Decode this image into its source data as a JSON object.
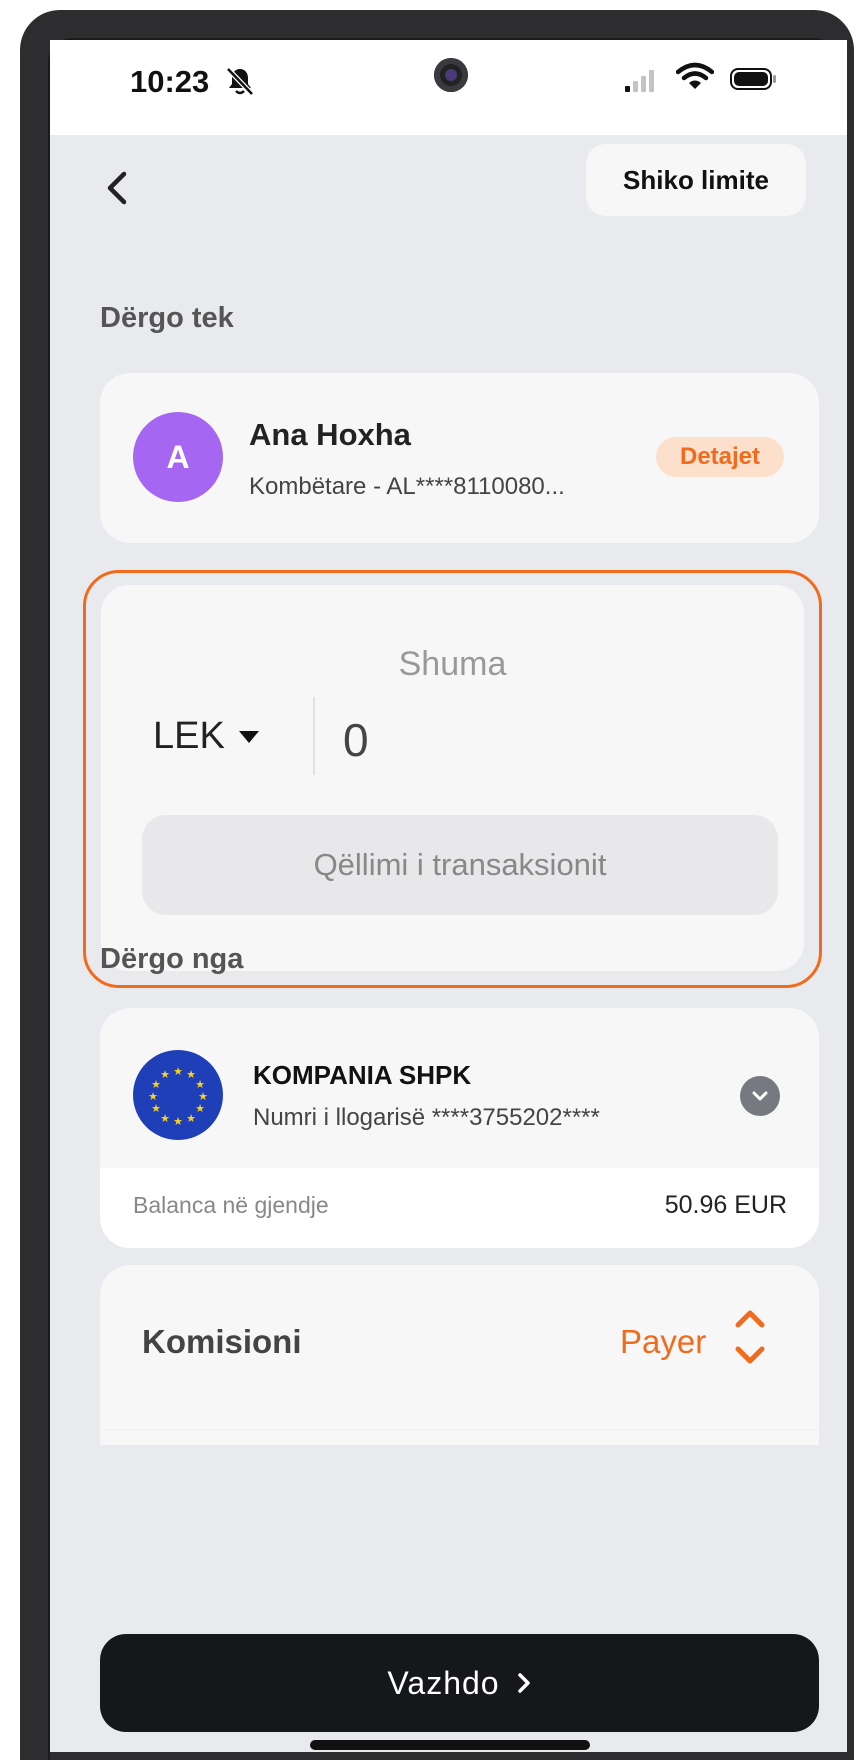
{
  "status_bar": {
    "time": "10:23"
  },
  "header": {
    "limits_label": "Shiko limite"
  },
  "recipient": {
    "section_label": "Dërgo tek",
    "avatar_letter": "A",
    "name": "Ana Hoxha",
    "account": "Kombëtare - AL****8110080...",
    "details_label": "Detajet"
  },
  "amount": {
    "label": "Shuma",
    "currency": "LEK",
    "value": "0",
    "purpose_placeholder": "Qëllimi i transaksionit"
  },
  "sender": {
    "section_label": "Dërgo nga",
    "company": "KOMPANIA SHPK",
    "account": "Numri i llogarisë ****3755202****",
    "balance_label": "Balanca në gjendje",
    "balance_value": "50.96 EUR"
  },
  "commission": {
    "label": "Komisioni",
    "value": "Payer"
  },
  "footer": {
    "continue_label": "Vazhdo"
  },
  "colors": {
    "accent": "#f26b1d",
    "avatar": "#a566f2",
    "button": "#16171a",
    "background": "#e9eaed"
  }
}
